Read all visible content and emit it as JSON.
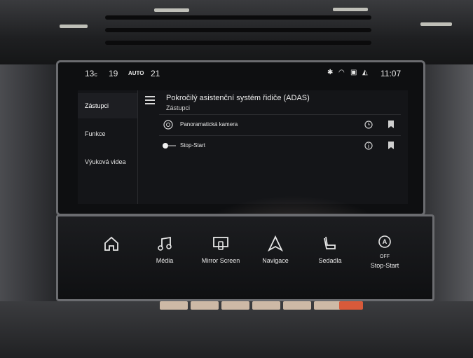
{
  "statusbar": {
    "temp_left": "13",
    "temp_left_unit": "c",
    "fan_left": "19",
    "auto": "AUTO",
    "temp_right": "21",
    "time": "11:07"
  },
  "sidebar": {
    "items": [
      {
        "label": "Zástupci",
        "active": true
      },
      {
        "label": "Funkce",
        "active": false
      },
      {
        "label": "Výuková videa",
        "active": false
      }
    ]
  },
  "page": {
    "title": "Pokročilý asistenční systém řidiče (ADAS)",
    "subtitle": "Zástupci"
  },
  "rows": [
    {
      "label": "Panoramatická kamera",
      "icon": "camera-icon",
      "right_icon": "history-icon"
    },
    {
      "label": "Stop-Start",
      "icon": "toggle-icon",
      "right_icon": "info-icon"
    }
  ],
  "bottom_bar": {
    "buttons": [
      {
        "label": "",
        "icon": "home-icon"
      },
      {
        "label": "Média",
        "icon": "music-note-icon"
      },
      {
        "label": "Mirror Screen",
        "icon": "mirror-screen-icon"
      },
      {
        "label": "Navigace",
        "icon": "navigation-arrow-icon"
      },
      {
        "label": "Sedadla",
        "icon": "seat-icon"
      },
      {
        "label": "Stop-Start",
        "icon": "stop-start-off-icon",
        "badge": "OFF"
      }
    ]
  }
}
